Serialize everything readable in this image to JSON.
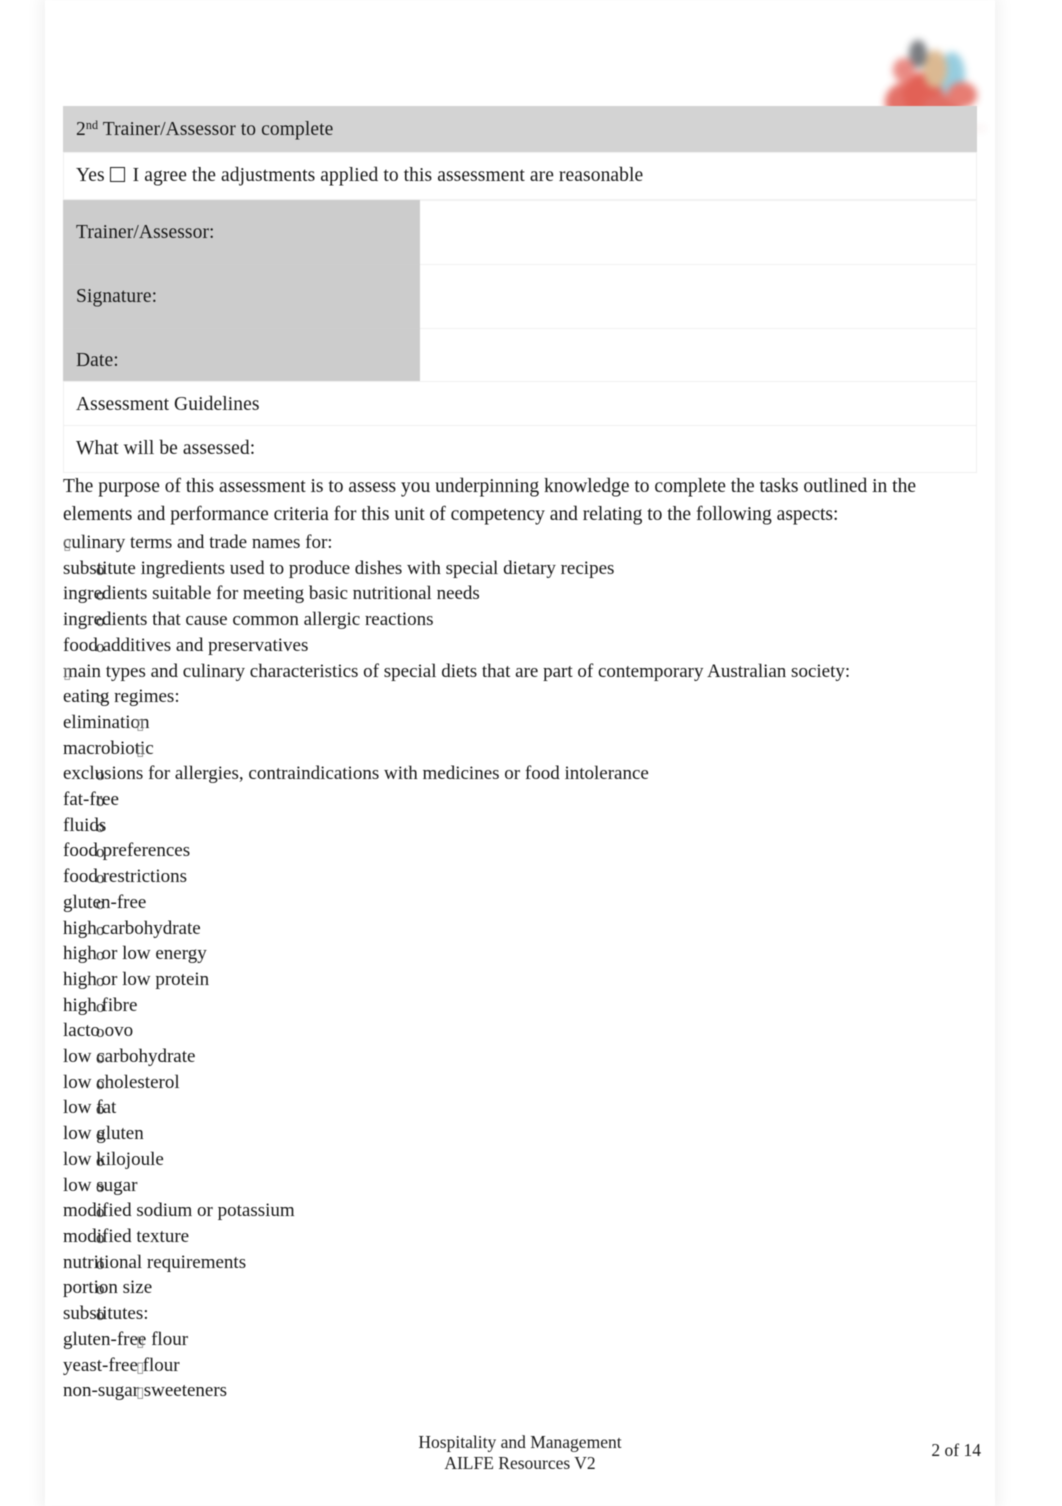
{
  "document": {
    "logo": {
      "name": "organisation-logo",
      "colors": [
        "#e05448",
        "#8ec9dd",
        "#d9b489",
        "#6f7277"
      ]
    },
    "header_band": {
      "prefix": "2",
      "superscript": "nd",
      "text": " Trainer/Assessor to complete"
    },
    "agreement_row": {
      "yes_label": "Yes",
      "checkbox_checked": false,
      "statement": "I agree the adjustments applied to this assessment are reasonable"
    },
    "signature_table": {
      "rows": [
        {
          "label": "Trainer/Assessor:",
          "value": ""
        },
        {
          "label": "Signature:",
          "value": ""
        },
        {
          "label": "Date:",
          "value": ""
        }
      ]
    },
    "guidelines_heading": "Assessment Guidelines",
    "what_heading": "What will be assessed:",
    "intro_paragraph": "The purpose of this assessment is to assess you underpinning knowledge to complete the tasks outlined in the elements and performance criteria for this unit of competency and relating to the following aspects:",
    "list": [
      {
        "level": 1,
        "text": "culinary terms and trade names for:"
      },
      {
        "level": 2,
        "text": "substitute ingredients used to produce dishes with special dietary recipes"
      },
      {
        "level": 2,
        "text": "ingredients suitable for meeting basic nutritional needs"
      },
      {
        "level": 2,
        "text": "ingredients that cause common allergic reactions"
      },
      {
        "level": 2,
        "text": "food additives and preservatives"
      },
      {
        "level": 1,
        "text": "main types and culinary characteristics of special diets that are part of contemporary Australian society:"
      },
      {
        "level": 2,
        "text": "eating regimes:"
      },
      {
        "level": 3,
        "text": "elimination"
      },
      {
        "level": 3,
        "text": "macrobiotic"
      },
      {
        "level": 2,
        "text": "exclusions for allergies, contraindications with medicines or food intolerance"
      },
      {
        "level": 2,
        "text": "fat-free"
      },
      {
        "level": 2,
        "text": "fluids"
      },
      {
        "level": 2,
        "text": "food preferences"
      },
      {
        "level": 2,
        "text": "food restrictions"
      },
      {
        "level": 2,
        "text": "gluten-free"
      },
      {
        "level": 2,
        "text": "high carbohydrate"
      },
      {
        "level": 2,
        "text": "high or low energy"
      },
      {
        "level": 2,
        "text": "high or low protein"
      },
      {
        "level": 2,
        "text": "high fibre"
      },
      {
        "level": 2,
        "text": "lacto ovo"
      },
      {
        "level": 2,
        "text": "low carbohydrate"
      },
      {
        "level": 2,
        "text": "low cholesterol"
      },
      {
        "level": 2,
        "text": "low fat"
      },
      {
        "level": 2,
        "text": "low gluten"
      },
      {
        "level": 2,
        "text": "low kilojoule"
      },
      {
        "level": 2,
        "text": "low sugar"
      },
      {
        "level": 2,
        "text": "modified sodium or potassium"
      },
      {
        "level": 2,
        "text": "modified texture"
      },
      {
        "level": 2,
        "text": "nutritional requirements"
      },
      {
        "level": 2,
        "text": "portion size"
      },
      {
        "level": 2,
        "text": "substitutes:"
      },
      {
        "level": 3,
        "text": "gluten-free flour"
      },
      {
        "level": 3,
        "text": "yeast-free flour"
      },
      {
        "level": 3,
        "text": "non-sugar sweeteners"
      }
    ],
    "footer": {
      "line1": "Hospitality and Management",
      "line2": "AILFE Resources V2",
      "page_number": "2 of 14"
    }
  }
}
